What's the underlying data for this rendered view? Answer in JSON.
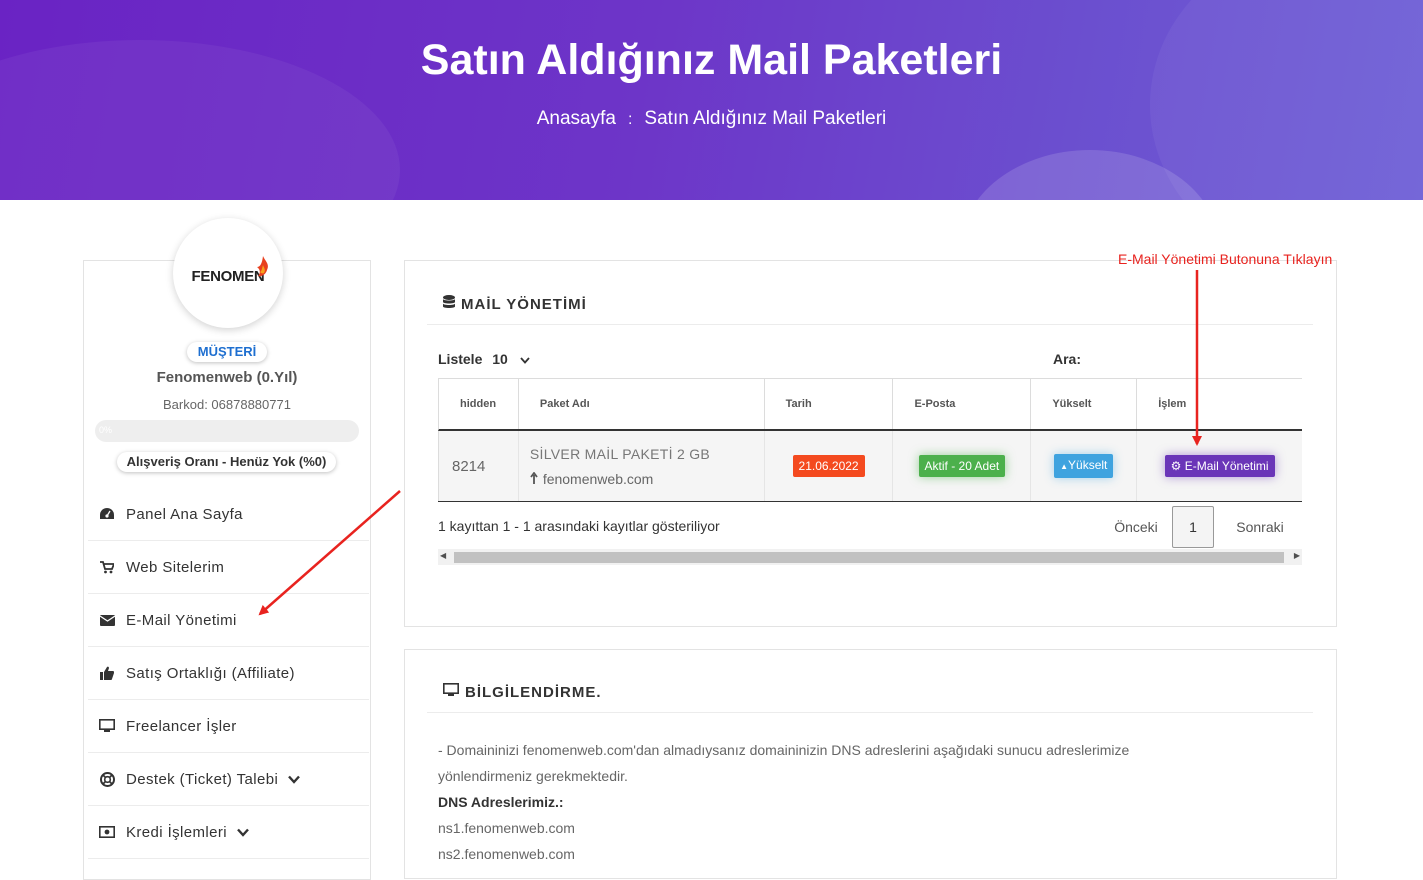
{
  "hero": {
    "title": "Satın Aldığınız Mail Paketleri",
    "breadcrumb": [
      "Anasayfa",
      "Satın Aldığınız Mail Paketleri"
    ],
    "breadcrumb_sep": ":"
  },
  "profile": {
    "logo_text": "FENOMEN",
    "role_badge": "MÜŞTERİ",
    "name": "Fenomenweb (0.Yıl)",
    "barcode": "Barkod: 06878880771",
    "progress_label": "0%",
    "progress_value": 0,
    "shopping_rate": "Alışveriş Oranı - Henüz Yok (%0)"
  },
  "menu": [
    {
      "label": "Panel Ana Sayfa",
      "icon": "dashboard-icon"
    },
    {
      "label": "Web Sitelerim",
      "icon": "cart-icon"
    },
    {
      "label": "E-Mail Yönetimi",
      "icon": "envelope-icon"
    },
    {
      "label": "Satış Ortaklığı (Affiliate)",
      "icon": "thumbs-up-icon"
    },
    {
      "label": "Freelancer İşler",
      "icon": "monitor-icon"
    },
    {
      "label": "Destek (Ticket) Talebi",
      "icon": "lifebuoy-icon",
      "expandable": true
    },
    {
      "label": "Kredi İşlemleri",
      "icon": "money-icon",
      "expandable": true
    }
  ],
  "mail_card": {
    "title": "MAİL YÖNETİMİ",
    "length_label": "Listele",
    "length_value": "10",
    "search_label": "Ara:",
    "columns": [
      "hidden",
      "Paket Adı",
      "Tarih",
      "E-Posta",
      "Yükselt",
      "İşlem"
    ],
    "rows": [
      {
        "id": "8214",
        "package_name": "SİLVER MAİL PAKETİ 2 GB",
        "domain": "fenomenweb.com",
        "date": "21.06.2022",
        "email_status": "Aktif - 20 Adet",
        "upgrade_label": "Yükselt",
        "action_label": "E-Mail Yönetimi"
      }
    ],
    "info": "1 kayıttan 1 - 1 arasındaki kayıtlar gösteriliyor",
    "pager": {
      "prev": "Önceki",
      "current": "1",
      "next": "Sonraki"
    }
  },
  "info_card": {
    "title": "BİLGİLENDİRME.",
    "line1": "- Domaininizi fenomenweb.com'dan almadıysanız domaininizin DNS adreslerini aşağıdaki sunucu adreslerimize",
    "line2": "yönlendirmeniz gerekmektedir.",
    "dns_heading": "DNS Adreslerimiz.:",
    "ns1": "ns1.fenomenweb.com",
    "ns2": "ns2.fenomenweb.com"
  },
  "annotation": {
    "text": "E-Mail Yönetimi Butonuna Tıklayın",
    "color": "#e8231f"
  },
  "colors": {
    "hero_gradient_start": "#6a23c4",
    "hero_gradient_end": "#6e5fd6",
    "date_badge": "#f44a1f",
    "active_badge": "#4cb04c",
    "upgrade_badge": "#3fa3df",
    "manage_badge": "#6a35b8"
  }
}
